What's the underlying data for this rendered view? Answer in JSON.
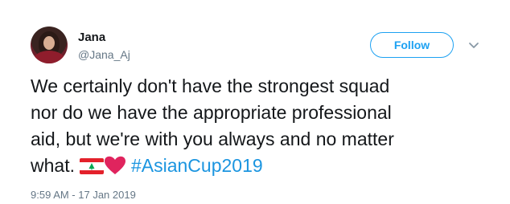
{
  "user": {
    "name": "Jana",
    "handle": "@Jana_Aj"
  },
  "actions": {
    "follow_label": "Follow",
    "menu_icon": "chevron-down-icon"
  },
  "tweet": {
    "line1": "We certainly don't have the strongest squad",
    "line2": "nor do we have the appropriate professional",
    "line3": "aid, but we're with you always and no matter",
    "line4_text": "what.",
    "emoji_flag": "lebanon-flag-icon",
    "emoji_heart": "red-heart-icon",
    "hashtag": "#AsianCup2019",
    "timestamp": "9:59 AM - 17 Jan 2019"
  },
  "colors": {
    "accent": "#1da1f2",
    "hashtag": "#1b95e0",
    "muted": "#657786",
    "heart": "#e0245e",
    "flag_red": "#e3212b",
    "cedar_green": "#00a651"
  }
}
